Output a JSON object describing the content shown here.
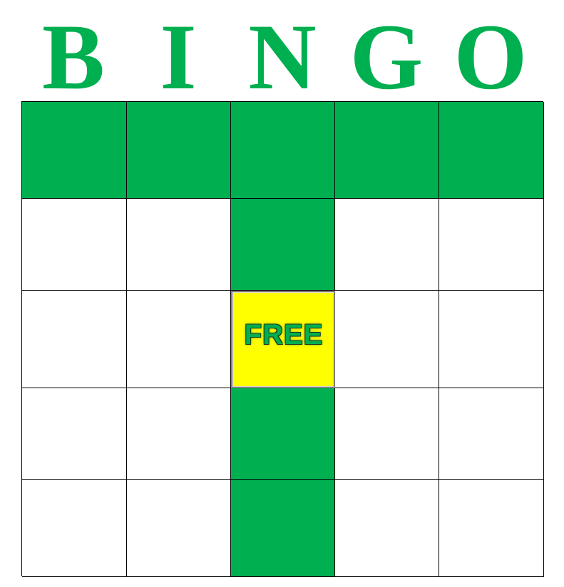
{
  "header": {
    "letters": [
      "B",
      "I",
      "N",
      "G",
      "O"
    ]
  },
  "board": {
    "free_label": "FREE",
    "colors": {
      "marked": "#00AF50",
      "unmarked": "#FFFFFF",
      "free": "#FFFF00",
      "letters": "#00AF50"
    },
    "marked": [
      [
        true,
        true,
        true,
        true,
        true
      ],
      [
        false,
        false,
        true,
        false,
        false
      ],
      [
        false,
        false,
        true,
        false,
        false
      ],
      [
        false,
        false,
        true,
        false,
        false
      ],
      [
        false,
        false,
        true,
        false,
        false
      ]
    ],
    "free_cell": [
      2,
      2
    ]
  }
}
